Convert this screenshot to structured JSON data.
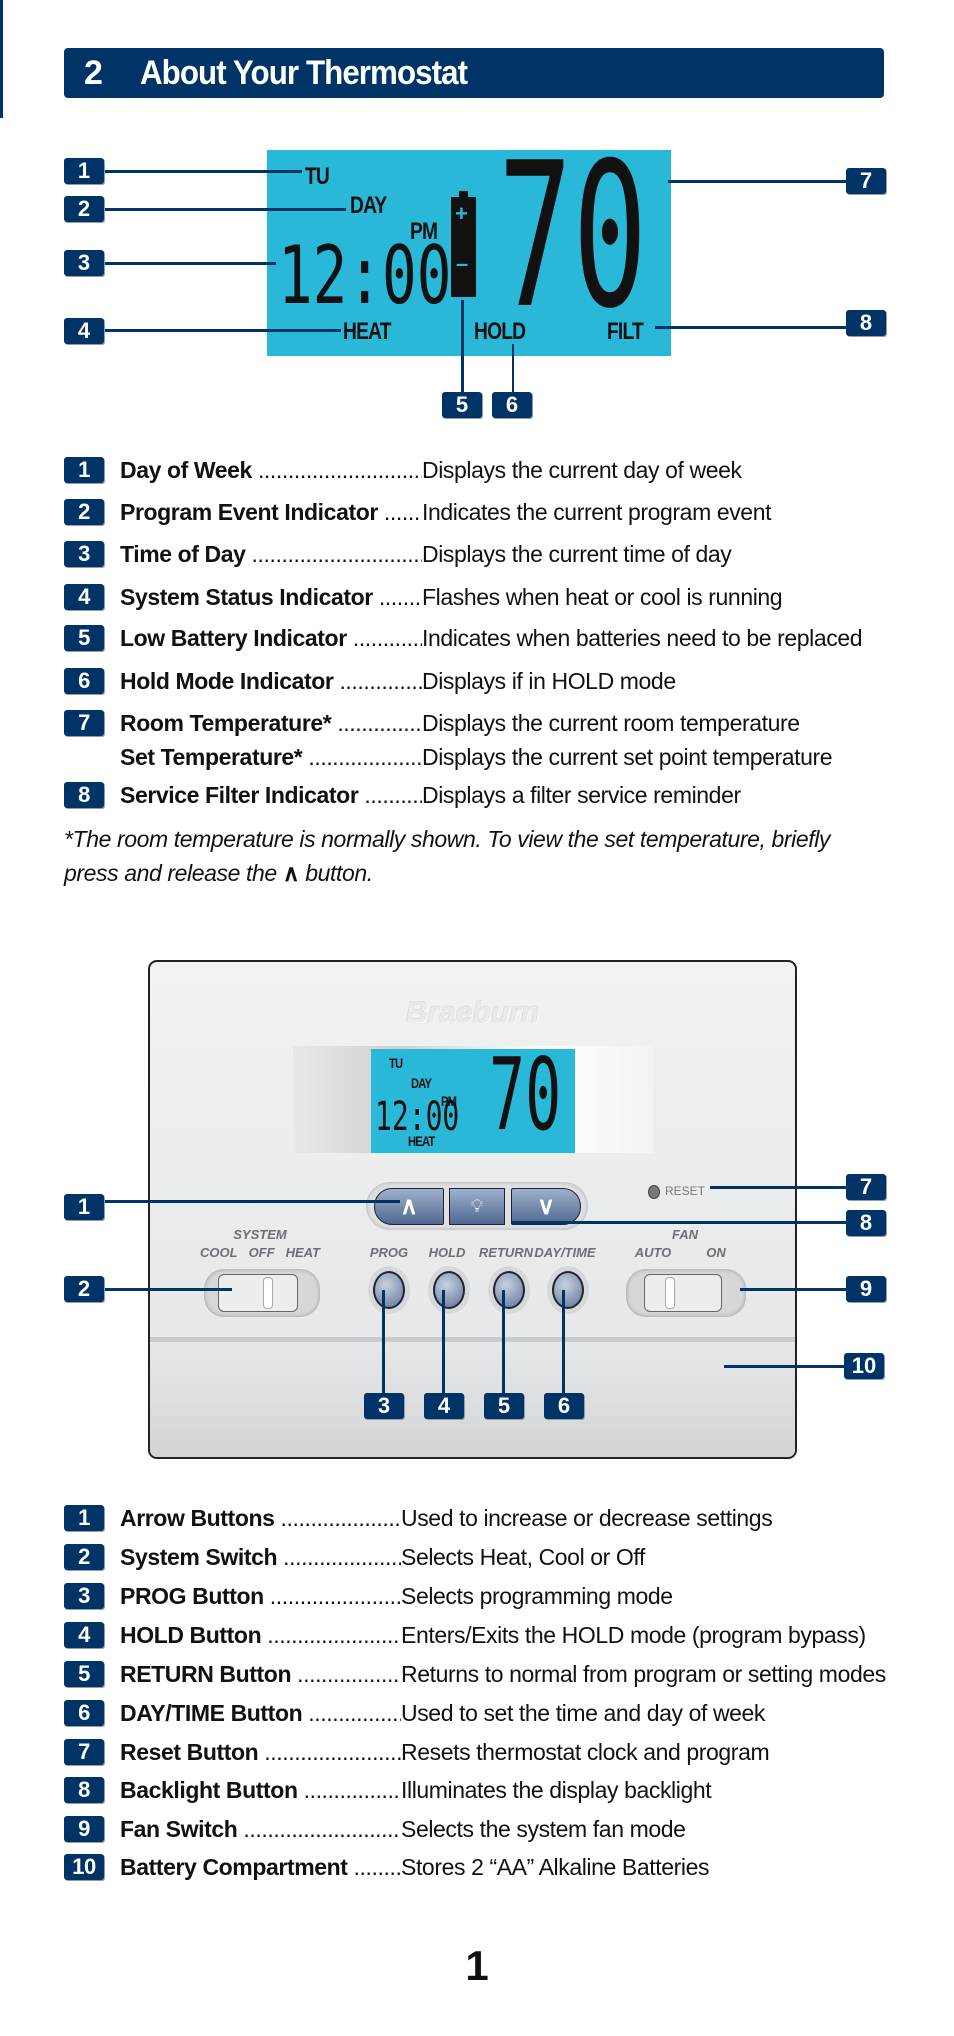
{
  "header": {
    "number": "2",
    "title": "About Your Thermostat"
  },
  "lcd": {
    "day": "TU",
    "program_event": "DAY",
    "ampm": "PM",
    "time": "12:00",
    "temperature": "70",
    "status": "HEAT",
    "hold": "HOLD",
    "filter": "FILT",
    "battery_plus": "+",
    "battery_minus": "–"
  },
  "display_callouts": [
    "1",
    "2",
    "3",
    "4",
    "5",
    "6",
    "7",
    "8"
  ],
  "display_items": [
    {
      "num": "1",
      "label": "Day of Week",
      "desc": "Displays the current day of week"
    },
    {
      "num": "2",
      "label": "Program Event Indicator",
      "desc": "Indicates the current program event"
    },
    {
      "num": "3",
      "label": "Time of Day",
      "desc": "Displays the current time of day"
    },
    {
      "num": "4",
      "label": "System Status Indicator",
      "desc": "Flashes when heat or cool is running"
    },
    {
      "num": "5",
      "label": "Low Battery Indicator",
      "desc": "Indicates when batteries need to be replaced"
    },
    {
      "num": "6",
      "label": "Hold Mode Indicator",
      "desc": "Displays if in HOLD mode"
    },
    {
      "num": "7",
      "label": "Room Temperature*",
      "desc": "Displays the current room temperature"
    },
    {
      "num": "",
      "label": "Set Temperature*",
      "desc": "Displays the current set point temperature"
    },
    {
      "num": "8",
      "label": "Service Filter Indicator",
      "desc": "Displays a filter service reminder"
    }
  ],
  "footnote": {
    "line1": "*The room temperature is normally shown. To view the set temperature, briefly",
    "line2_before": "press and release the",
    "line2_icon": "up-caret-icon",
    "line2_after": "button."
  },
  "device": {
    "brand": "Braeburn",
    "reset": "RESET",
    "system_label": "SYSTEM",
    "system_cool": "COOL",
    "system_off": "OFF",
    "system_heat": "HEAT",
    "buttons": [
      "PROG",
      "HOLD",
      "RETURN",
      "DAY/TIME"
    ],
    "fan_label": "FAN",
    "fan_auto": "AUTO",
    "fan_on": "ON",
    "lcd": {
      "day": "TU",
      "event": "DAY",
      "ampm": "PM",
      "time": "12:00",
      "temp": "70",
      "status": "HEAT"
    }
  },
  "device_callouts": [
    "1",
    "2",
    "3",
    "4",
    "5",
    "6",
    "7",
    "8",
    "9",
    "10"
  ],
  "device_items": [
    {
      "num": "1",
      "label": "Arrow Buttons",
      "desc": "Used to increase or decrease settings"
    },
    {
      "num": "2",
      "label": "System Switch",
      "desc": "Selects Heat, Cool or Off"
    },
    {
      "num": "3",
      "label": "PROG Button",
      "desc": "Selects programming mode"
    },
    {
      "num": "4",
      "label": "HOLD Button",
      "desc": "Enters/Exits the HOLD mode (program bypass)"
    },
    {
      "num": "5",
      "label": "RETURN Button",
      "desc": "Returns to normal from program or setting modes"
    },
    {
      "num": "6",
      "label": "DAY/TIME Button",
      "desc": "Used to set the time and day of week"
    },
    {
      "num": "7",
      "label": "Reset Button",
      "desc": "Resets thermostat clock and program"
    },
    {
      "num": "8",
      "label": "Backlight Button",
      "desc": "Illuminates the display backlight"
    },
    {
      "num": "9",
      "label": "Fan Switch",
      "desc": "Selects the system fan mode"
    },
    {
      "num": "10",
      "label": "Battery Compartment",
      "desc": "Stores 2 “AA” Alkaline Batteries"
    }
  ],
  "page_number": "1",
  "colors": {
    "navy": "#003366",
    "lcd": "#29b8d8"
  }
}
